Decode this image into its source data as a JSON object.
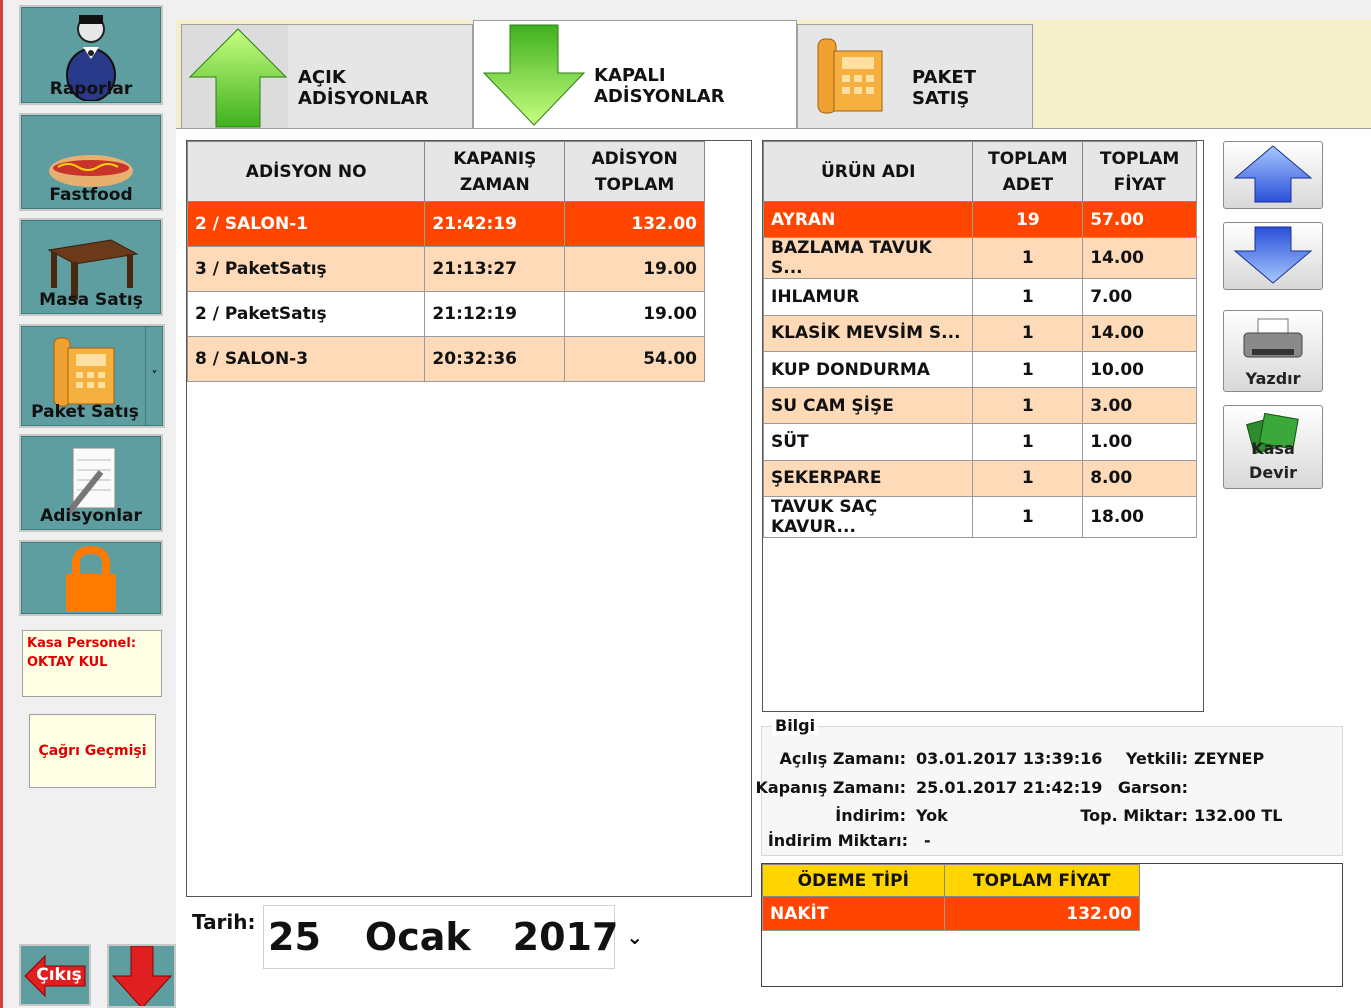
{
  "sidebar": {
    "raporlar": "Raporlar",
    "fastfood": "Fastfood",
    "masa_satis": "Masa Satış",
    "paket_satis": "Paket Satış",
    "paket_dropdown": "˅",
    "adisyonlar": "Adisyonlar",
    "kasa_personel_label": "Kasa Personel:",
    "kasa_personel_name": "OKTAY KUL",
    "cagri_gecmisi": "Çağrı Geçmişi",
    "cikis": "Çıkış"
  },
  "tabs": [
    {
      "label": "AÇIK ADİSYONLAR",
      "icon": "up-arrow-icon"
    },
    {
      "label": "KAPALI ADİSYONLAR",
      "icon": "down-arrow-icon"
    },
    {
      "label": "PAKET SATIŞ",
      "icon": "phone-icon"
    }
  ],
  "adisyon_table": {
    "headers": [
      "ADİSYON NO",
      "KAPANIŞ ZAMAN",
      "ADİSYON TOPLAM"
    ],
    "header_lines": [
      [
        "ADİSYON NO"
      ],
      [
        "KAPANIŞ",
        "ZAMAN"
      ],
      [
        "ADİSYON",
        "TOPLAM"
      ]
    ],
    "rows": [
      {
        "no": "2 / SALON-1",
        "time": "21:42:19",
        "total": "132.00",
        "state": "selected"
      },
      {
        "no": "3 / PaketSatış",
        "time": "21:13:27",
        "total": "19.00",
        "state": "alt"
      },
      {
        "no": "2 / PaketSatış",
        "time": "21:12:19",
        "total": "19.00",
        "state": "white"
      },
      {
        "no": "8 / SALON-3",
        "time": "20:32:36",
        "total": "54.00",
        "state": "alt"
      }
    ]
  },
  "urun_table": {
    "header_lines": [
      [
        "ÜRÜN ADI"
      ],
      [
        "TOPLAM",
        "ADET"
      ],
      [
        "TOPLAM",
        "FİYAT"
      ]
    ],
    "rows": [
      {
        "name": "AYRAN",
        "adet": "19",
        "fiyat": "57.00",
        "state": "selected"
      },
      {
        "name": "BAZLAMA TAVUK S...",
        "adet": "1",
        "fiyat": "14.00",
        "state": "alt"
      },
      {
        "name": "IHLAMUR",
        "adet": "1",
        "fiyat": "7.00",
        "state": "white"
      },
      {
        "name": "KLASİK MEVSİM S...",
        "adet": "1",
        "fiyat": "14.00",
        "state": "alt"
      },
      {
        "name": "KUP DONDURMA",
        "adet": "1",
        "fiyat": "10.00",
        "state": "white"
      },
      {
        "name": "SU CAM ŞİŞE",
        "adet": "1",
        "fiyat": "3.00",
        "state": "alt"
      },
      {
        "name": "SÜT",
        "adet": "1",
        "fiyat": "1.00",
        "state": "white"
      },
      {
        "name": "ŞEKERPARE",
        "adet": "1",
        "fiyat": "8.00",
        "state": "alt"
      },
      {
        "name": "TAVUK SAÇ KAVUR...",
        "adet": "1",
        "fiyat": "18.00",
        "state": "white"
      }
    ]
  },
  "right_buttons": {
    "yazdir": "Yazdır",
    "kasa_devir_1": "Kasa",
    "kasa_devir_2": "Devir"
  },
  "bilgi": {
    "legend": "Bilgi",
    "acilis_label": "Açılış Zamanı:",
    "acilis_value": "03.01.2017 13:39:16",
    "kapanis_label": "Kapanış Zamanı:",
    "kapanis_value": "25.01.2017 21:42:19",
    "indirim_label": "İndirim:",
    "indirim_value": "Yok",
    "indirim_miktari_label": "İndirim Miktarı:",
    "indirim_miktari_value": "-",
    "yetkili_label": "Yetkili:",
    "yetkili_value": "ZEYNEP",
    "garson_label": "Garson:",
    "garson_value": "",
    "top_miktar_label": "Top. Miktar:",
    "top_miktar_value": "132.00  TL"
  },
  "odeme": {
    "headers": [
      "ÖDEME TİPİ",
      "TOPLAM FİYAT"
    ],
    "rows": [
      {
        "tip": "NAKİT",
        "fiyat": "132.00"
      }
    ]
  },
  "tarih": {
    "label": "Tarih:",
    "day": "25",
    "month": "Ocak",
    "year": "2017",
    "dropdown": "⌄"
  },
  "colors": {
    "sidebar_teal": "#5f9ea0",
    "selected_row": "#ff4500",
    "alt_row": "#ffdab9",
    "payment_header": "#ffd400",
    "tab_strip": "#f4efc8"
  }
}
